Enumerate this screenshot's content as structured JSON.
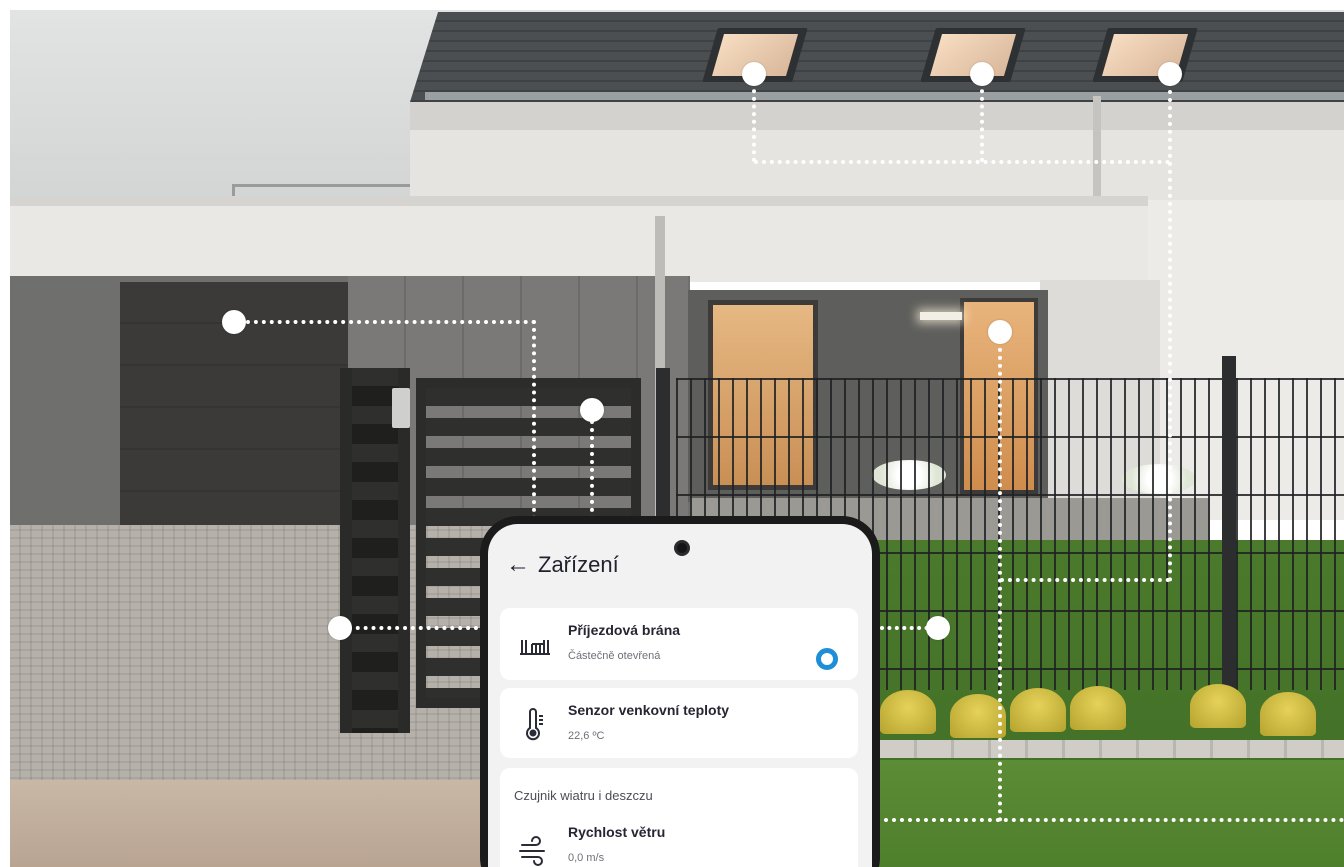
{
  "app": {
    "back_icon": "arrow-left-icon",
    "title": "Zařízení"
  },
  "devices": [
    {
      "icon": "gate-icon",
      "name": "Příjezdová brána",
      "status": "Částečně otevřená",
      "indicator": "partially-open",
      "indicator_color": "#1e8fd6"
    },
    {
      "icon": "thermometer-icon",
      "name": "Senzor venkovní teploty",
      "status": "22,6 ºC"
    }
  ],
  "group": {
    "title": "Czujnik wiatru i deszczu",
    "items": [
      {
        "icon": "wind-icon",
        "name": "Rychlost větru",
        "status": "0,0 m/s"
      }
    ]
  },
  "colors": {
    "accent": "#1e8fd6",
    "card_bg": "#ffffff",
    "screen_bg": "#f2f2f2"
  }
}
